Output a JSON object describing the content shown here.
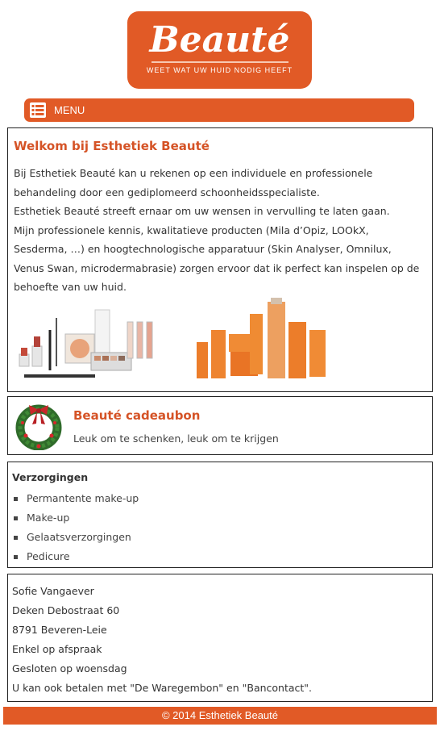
{
  "logo": {
    "title": "Beauté",
    "tagline": "WEET WAT UW HUID NODIG HEEFT"
  },
  "menu": {
    "label": "MENU",
    "icon": "menu-list-icon"
  },
  "welcome": {
    "title": "Welkom bij Esthetiek Beauté",
    "paragraphs": [
      "Bij Esthetiek Beauté kan u rekenen op een individuele en professionele behandeling door een gediplomeerd schoonheidsspecialiste.",
      "Esthetiek Beauté streeft ernaar om uw wensen in vervulling te laten gaan.",
      "Mijn professionele kennis, kwalitatieve producten (Mila d’Opiz, LOOkX, Sesderma, …) en hoogtechnologische apparatuur (Skin Analyser, Omnilux, Venus Swan, microdermabrasie) zorgen ervoor dat ik perfect kan inspelen op de behoefte van uw huid."
    ]
  },
  "gift": {
    "title": "Beauté cadeaubon",
    "subtitle": "Leuk om te schenken, leuk om te krijgen"
  },
  "services": {
    "title": "Verzorgingen",
    "items": [
      "Permantente make-up",
      "Make-up",
      "Gelaatsverzorgingen",
      "Pedicure"
    ]
  },
  "contact": {
    "lines": [
      "Sofie Vangaever",
      "Deken Debostraat 60",
      "8791 Beveren-Leie",
      "Enkel op afspraak",
      "Gesloten op woensdag",
      "U kan ook betalen met \"De Waregembon\" en \"Bancontact\"."
    ]
  },
  "footer": {
    "text": "© 2014 Esthetiek Beauté"
  },
  "colors": {
    "accent": "#e15a26",
    "heading": "#d55326"
  }
}
